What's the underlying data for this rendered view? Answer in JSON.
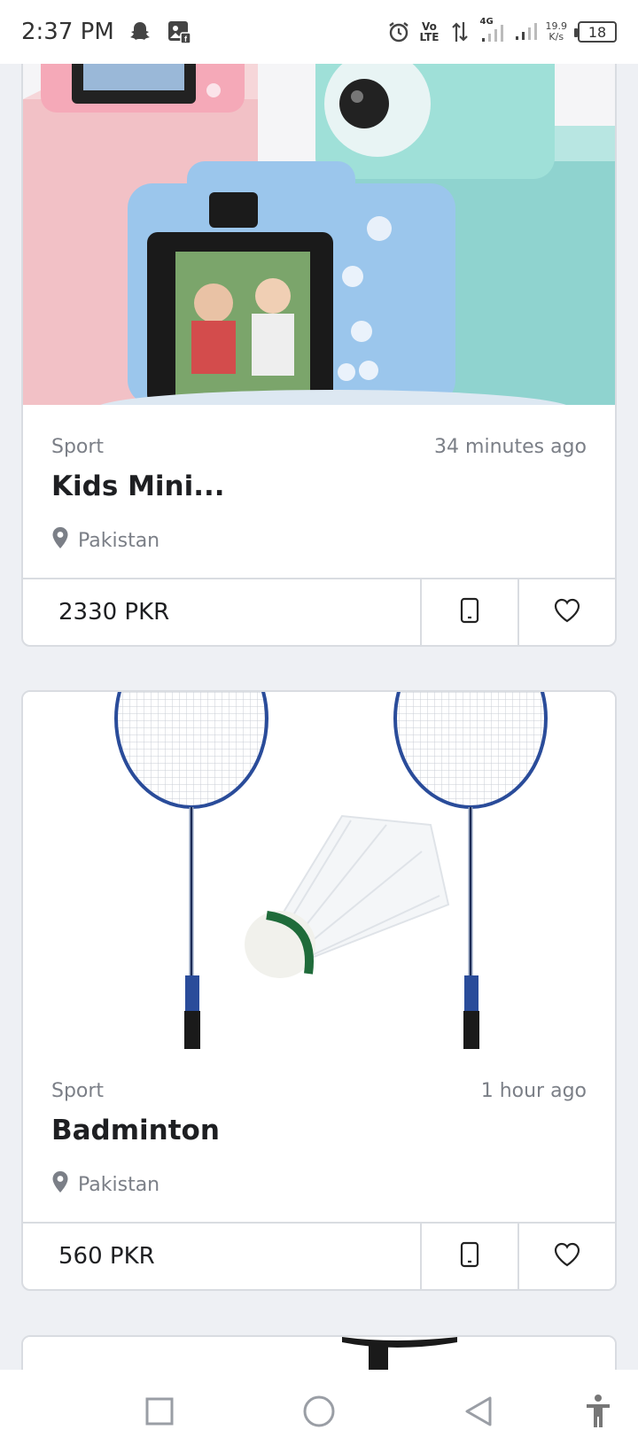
{
  "status_bar": {
    "time": "2:37 PM",
    "icons": [
      "snapchat-icon",
      "facebook-gallery-icon",
      "alarm-icon",
      "volte-icon",
      "data-arrows-icon",
      "signal-icon",
      "signal-2-icon"
    ],
    "volte_top": "Vo",
    "volte_bottom": "LTE",
    "network": "4G",
    "speed_value": "19.9",
    "speed_unit": "K/s",
    "battery": "18"
  },
  "listings": [
    {
      "category": "Sport",
      "time_ago": "34 minutes ago",
      "title": "Kids Mini...",
      "location": "Pakistan",
      "price": "2330 PKR",
      "image": "kids-camera-photo"
    },
    {
      "category": "Sport",
      "time_ago": "1 hour ago",
      "title": "Badminton",
      "location": "Pakistan",
      "price": "560 PKR",
      "image": "badminton-photo"
    }
  ],
  "nav": {
    "icons": [
      "recent-apps-icon",
      "home-icon",
      "back-icon",
      "accessibility-icon"
    ]
  },
  "colors": {
    "background": "#eef0f4",
    "text": "#1e1f22",
    "muted": "#7b7f87",
    "border": "#d9dce1"
  }
}
